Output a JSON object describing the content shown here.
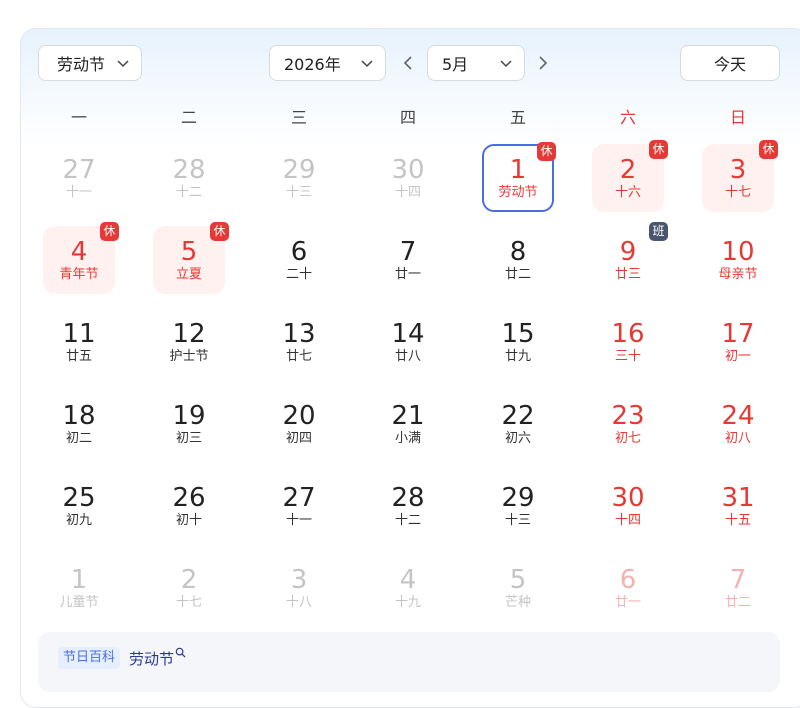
{
  "toolbar": {
    "holiday": "劳动节",
    "year": "2026年",
    "month": "5月",
    "today": "今天"
  },
  "weekdays": [
    "一",
    "二",
    "三",
    "四",
    "五",
    "六",
    "日"
  ],
  "rows": [
    [
      {
        "day": "27",
        "sub": "十一",
        "other": true
      },
      {
        "day": "28",
        "sub": "十二",
        "other": true
      },
      {
        "day": "29",
        "sub": "十三",
        "other": true
      },
      {
        "day": "30",
        "sub": "十四",
        "other": true
      },
      {
        "day": "1",
        "sub": "劳动节",
        "selected": true,
        "badge": "休"
      },
      {
        "day": "2",
        "sub": "十六",
        "rest": true,
        "badge": "休"
      },
      {
        "day": "3",
        "sub": "十七",
        "rest": true,
        "badge": "休"
      }
    ],
    [
      {
        "day": "4",
        "sub": "青年节",
        "rest": true,
        "badge": "休"
      },
      {
        "day": "5",
        "sub": "立夏",
        "rest": true,
        "badge": "休"
      },
      {
        "day": "6",
        "sub": "二十"
      },
      {
        "day": "7",
        "sub": "廿一"
      },
      {
        "day": "8",
        "sub": "廿二"
      },
      {
        "day": "9",
        "sub": "廿三",
        "badge": "班",
        "work": true
      },
      {
        "day": "10",
        "sub": "母亲节"
      }
    ],
    [
      {
        "day": "11",
        "sub": "廿五"
      },
      {
        "day": "12",
        "sub": "护士节"
      },
      {
        "day": "13",
        "sub": "廿七"
      },
      {
        "day": "14",
        "sub": "廿八"
      },
      {
        "day": "15",
        "sub": "廿九"
      },
      {
        "day": "16",
        "sub": "三十"
      },
      {
        "day": "17",
        "sub": "初一"
      }
    ],
    [
      {
        "day": "18",
        "sub": "初二"
      },
      {
        "day": "19",
        "sub": "初三"
      },
      {
        "day": "20",
        "sub": "初四"
      },
      {
        "day": "21",
        "sub": "小满"
      },
      {
        "day": "22",
        "sub": "初六"
      },
      {
        "day": "23",
        "sub": "初七"
      },
      {
        "day": "24",
        "sub": "初八"
      }
    ],
    [
      {
        "day": "25",
        "sub": "初九"
      },
      {
        "day": "26",
        "sub": "初十"
      },
      {
        "day": "27",
        "sub": "十一"
      },
      {
        "day": "28",
        "sub": "十二"
      },
      {
        "day": "29",
        "sub": "十三"
      },
      {
        "day": "30",
        "sub": "十四"
      },
      {
        "day": "31",
        "sub": "十五"
      }
    ],
    [
      {
        "day": "1",
        "sub": "儿童节",
        "other": true
      },
      {
        "day": "2",
        "sub": "十七",
        "other": true
      },
      {
        "day": "3",
        "sub": "十八",
        "other": true
      },
      {
        "day": "4",
        "sub": "十九",
        "other": true
      },
      {
        "day": "5",
        "sub": "芒种",
        "other": true
      },
      {
        "day": "6",
        "sub": "廿一",
        "other": true
      },
      {
        "day": "7",
        "sub": "廿二",
        "other": true
      }
    ]
  ],
  "footer": {
    "tag": "节日百科",
    "link": "劳动节"
  },
  "colors": {
    "accent": "#4a6ee0",
    "holiday_red": "#e53935",
    "rest_bg": "#fff1ef",
    "work_badge": "#4a5670"
  },
  "icons": {
    "dropdown": "chevron-down-icon",
    "prev": "chevron-left-icon",
    "next": "chevron-right-icon",
    "search": "search-icon"
  }
}
